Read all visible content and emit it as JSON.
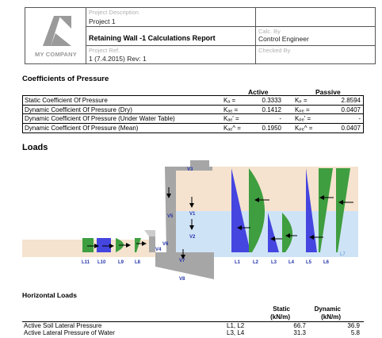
{
  "header": {
    "logo_text": "MY COMPANY",
    "project_description_label": "Project Description",
    "project_description_value": "Project 1",
    "report_title": "Retaining Wall -1 Calculations Report",
    "calc_by_label": "Calc. By",
    "calc_by_value": "Control Engineer",
    "project_ref_label": "Project Ref.",
    "project_ref_value": "1 (7.4.2015)   Rev: 1",
    "checked_by_label": "Checked By"
  },
  "coefficients": {
    "title": "Coefficients of Pressure",
    "col_active": "Active",
    "col_passive": "Passive",
    "rows": [
      {
        "label": "Static Coefficient Of Pressure",
        "sym_active": "Kₐ =",
        "active": "0.3333",
        "sym_passive": "Kₚ =",
        "passive": "2.8594"
      },
      {
        "label": "Dynamic Coefficient Of Pressure (Dry)",
        "sym_active": "Kₐₑ =",
        "active": "0.1412",
        "sym_passive": "Kₚₑ =",
        "passive": "0.0407"
      },
      {
        "label": "Dynamic Coefficient Of Pressure (Under Water Table)",
        "sym_active": "Kₐₑ' =",
        "active": "-",
        "sym_passive": "Kₚₑ' =",
        "passive": "-"
      },
      {
        "label": "Dynamic Coefficient Of Pressure (Mean)",
        "sym_active": "Kₐₑ^ =",
        "active": "0.1950",
        "sym_passive": "Kₚₑ^ =",
        "passive": "0.0407"
      }
    ]
  },
  "loads": {
    "title": "Loads",
    "labels": {
      "v3": "V3",
      "v5": "V5",
      "v1": "V1",
      "v2": "V2",
      "v6": "V6",
      "v4": "V4",
      "v7": "V7",
      "v8": "V8",
      "l1": "L1",
      "l2": "L2",
      "l3": "L3",
      "l4": "L4",
      "l5": "L5",
      "l6": "L6",
      "l7": "L7",
      "l8": "L8",
      "l9": "L9",
      "l10": "L10",
      "l11": "L11"
    },
    "colors": {
      "soil_dry": "#f5e3cf",
      "soil_wet": "#cfe3f6",
      "wall": "#a6a6a6",
      "pressure_blue": "#4545e0",
      "pressure_green": "#3f9e3f"
    }
  },
  "horizontal_loads": {
    "title": "Horizontal Loads",
    "col_static": "Static",
    "col_static_unit": "(kN/m)",
    "col_dynamic": "Dynamic",
    "col_dynamic_unit": "(kN/m)",
    "rows": [
      {
        "label": "Active Soil Lateral Pressure",
        "cases": "L1, L2",
        "static": "66.7",
        "dynamic": "36.9"
      },
      {
        "label": "Active Lateral Pressure of Water",
        "cases": "L3, L4",
        "static": "31.3",
        "dynamic": "5.8"
      }
    ]
  }
}
